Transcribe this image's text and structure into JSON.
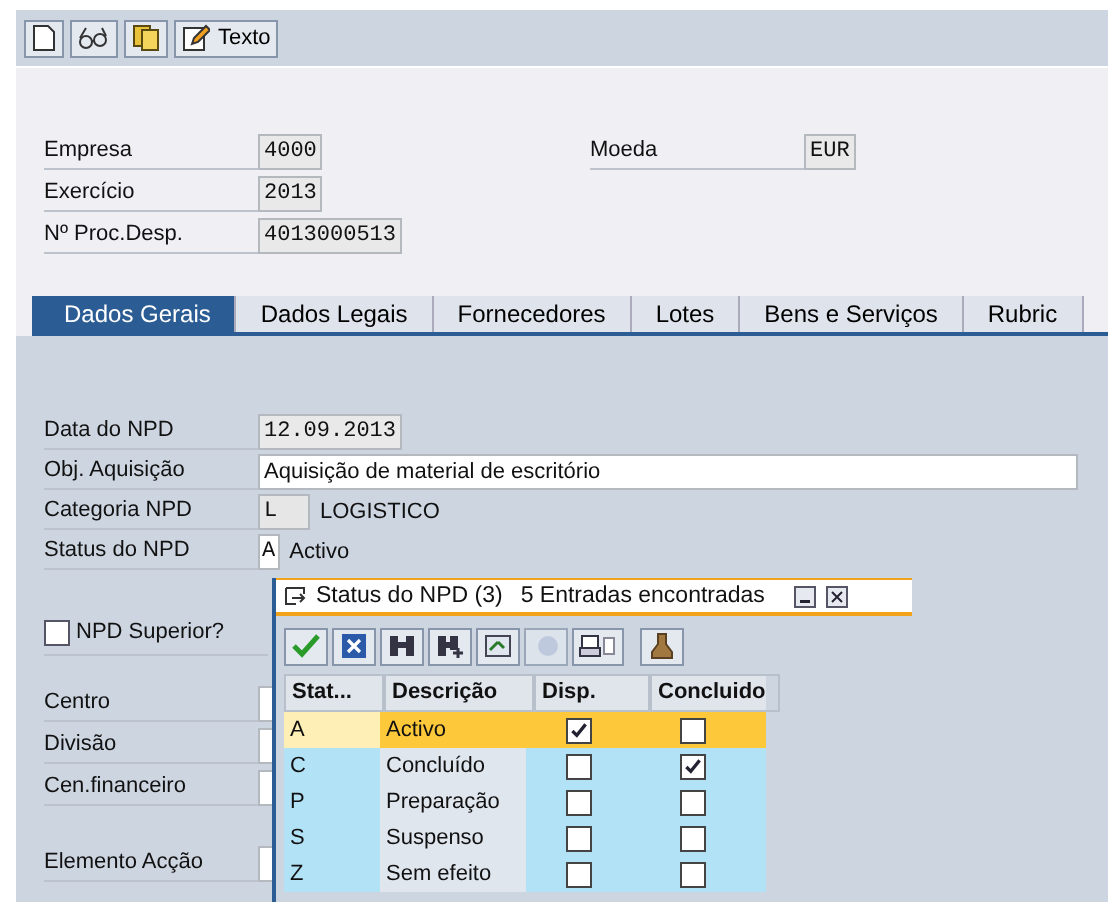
{
  "toolbar": [
    {
      "kind": "icon"
    },
    {
      "kind": "icon"
    },
    {
      "kind": "icon"
    },
    {
      "kind": "text",
      "label": "Texto"
    }
  ],
  "header_fields": [
    {
      "label": "Empresa",
      "value": "4000"
    },
    {
      "label": "Exercício",
      "value": "2013"
    },
    {
      "label": "Nº Proc.Desp.",
      "value": "4013000513"
    }
  ],
  "currency": {
    "label": "Moeda",
    "value": "EUR"
  },
  "tabs": [
    {
      "label": "Dados Gerais",
      "selected": true
    },
    {
      "label": "Dados Legais",
      "selected": false
    },
    {
      "label": "Fornecedores",
      "selected": false
    },
    {
      "label": "Lotes",
      "selected": false
    },
    {
      "label": "Bens e Serviços",
      "selected": false
    },
    {
      "label": "Rubric",
      "selected": false
    }
  ],
  "general": {
    "date": {
      "label": "Data do NPD",
      "value": "12.09.2013"
    },
    "object": {
      "label": "Obj. Aquisição",
      "value": "Aquisição de material de escritório"
    },
    "category": {
      "label": "Categoria NPD",
      "value": "L",
      "text": "LOGISTICO"
    },
    "status": {
      "label": "Status do NPD",
      "value": "A",
      "text": "Activo"
    }
  },
  "superior": {
    "label": "NPD Superior?",
    "checked": false
  },
  "org_fields": [
    {
      "label": "Centro"
    },
    {
      "label": "Divisão"
    },
    {
      "label": "Cen.financeiro"
    }
  ],
  "action_field": {
    "label": "Elemento Acção"
  },
  "popup": {
    "title": "Status do NPD (3)",
    "subtitle": "5 Entradas encontradas",
    "columns": [
      "Stat...",
      "Descrição",
      "Disp.",
      "Concluido"
    ],
    "rows": [
      {
        "code": "A",
        "description": "Activo",
        "available": true,
        "completed": false,
        "selected": true
      },
      {
        "code": "C",
        "description": "Concluído",
        "available": false,
        "completed": true,
        "selected": false
      },
      {
        "code": "P",
        "description": "Preparação",
        "available": false,
        "completed": false,
        "selected": false
      },
      {
        "code": "S",
        "description": "Suspenso",
        "available": false,
        "completed": false,
        "selected": false
      },
      {
        "code": "Z",
        "description": "Sem efeito",
        "available": false,
        "completed": false,
        "selected": false
      }
    ]
  }
}
